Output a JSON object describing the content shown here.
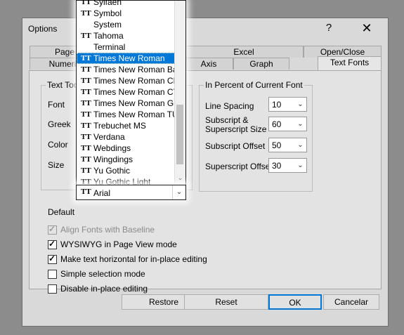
{
  "window": {
    "title": "Options",
    "help": "?",
    "close": "✕"
  },
  "tabs_back": [
    "Page",
    "Excel",
    "Open/Close"
  ],
  "tabs_front": [
    "Numeric",
    "Axis",
    "Graph",
    "Text Fonts"
  ],
  "text_tool": {
    "group_title": "Text Too",
    "labels": [
      "Font",
      "Greek",
      "Color",
      "Size"
    ],
    "default_label": "Default",
    "default_value": "Arial"
  },
  "percent_group": {
    "title": "In Percent of Current Font",
    "rows": [
      {
        "label": "Line Spacing",
        "value": "10"
      },
      {
        "label": "Subscript & Superscript Size",
        "value": "60"
      },
      {
        "label": "Subscript Offset",
        "value": "50"
      },
      {
        "label": "Superscript Offset",
        "value": "30"
      }
    ]
  },
  "checkboxes": [
    {
      "label": "Align Fonts with Baseline",
      "checked": true,
      "disabled": true
    },
    {
      "label": "WYSIWYG in Page View mode",
      "checked": true,
      "disabled": false
    },
    {
      "label": "Make text horizontal for in-place editing",
      "checked": true,
      "disabled": false
    },
    {
      "label": "Simple selection mode",
      "checked": false,
      "disabled": false
    },
    {
      "label": "Disable in-place editing",
      "checked": false,
      "disabled": false
    }
  ],
  "buttons": [
    "Restore",
    "Reset",
    "OK",
    "Cancelar"
  ],
  "font_list": {
    "selected": "Times New Roman",
    "items": [
      {
        "name": "Sylfaen",
        "tt": true
      },
      {
        "name": "Symbol",
        "tt": true
      },
      {
        "name": "System",
        "tt": false
      },
      {
        "name": "Tahoma",
        "tt": true
      },
      {
        "name": "Terminal",
        "tt": false
      },
      {
        "name": "Times New Roman",
        "tt": true
      },
      {
        "name": "Times New Roman Baltic",
        "tt": true
      },
      {
        "name": "Times New Roman CE",
        "tt": true
      },
      {
        "name": "Times New Roman CYR",
        "tt": true
      },
      {
        "name": "Times New Roman Greek",
        "tt": true
      },
      {
        "name": "Times New Roman TUR",
        "tt": true
      },
      {
        "name": "Trebuchet MS",
        "tt": true
      },
      {
        "name": "Verdana",
        "tt": true
      },
      {
        "name": "Webdings",
        "tt": true
      },
      {
        "name": "Wingdings",
        "tt": true
      },
      {
        "name": "Yu Gothic",
        "tt": true
      },
      {
        "name": "Yu Gothic Light",
        "tt": true
      }
    ]
  }
}
